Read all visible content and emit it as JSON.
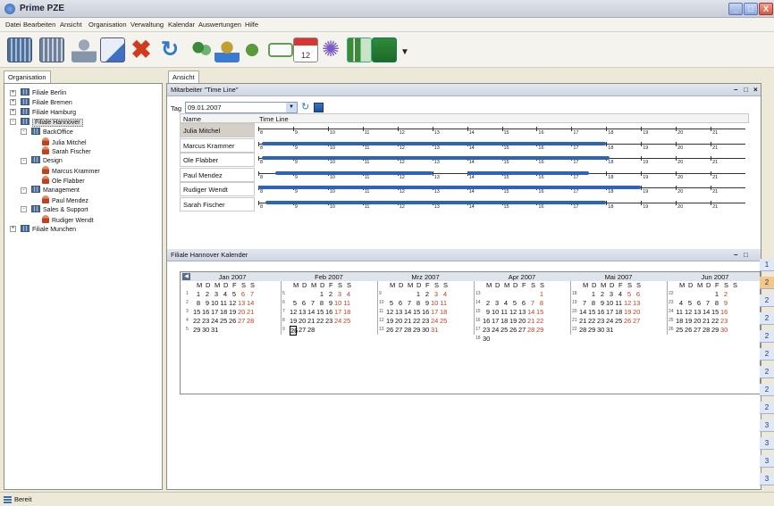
{
  "window": {
    "title": "Prime PZE",
    "btn_min": "_",
    "btn_max": "□",
    "btn_close": "X"
  },
  "menu": [
    "Datei",
    "Bearbeiten",
    "Ansicht",
    "Organisation",
    "Verwaltung",
    "Kalendar",
    "Auswertungen",
    "Hilfe"
  ],
  "toolbar": {
    "icons": [
      "table-icon",
      "database-icon",
      "user-icon",
      "edit-icon",
      "delete-icon",
      "refresh-icon",
      "users-group-icon",
      "export-icon",
      "import-icon",
      "tag-icon",
      "calendar-icon",
      "settings-icon",
      "chart-icon",
      "excel-icon",
      "dropdown-arrow-icon"
    ],
    "colors": {
      "accent": "#2f5fae",
      "delete": "#d23a1e",
      "excel": "#2f8a3a"
    }
  },
  "left_tab": "Organisation",
  "right_tab": "Ansicht",
  "tree": [
    {
      "label": "Filiale Berlin",
      "level": 0,
      "type": "folder",
      "exp": "+"
    },
    {
      "label": "Filiale Bremen",
      "level": 0,
      "type": "folder",
      "exp": "+"
    },
    {
      "label": "Filiale Hamburg",
      "level": 0,
      "type": "folder",
      "exp": "+"
    },
    {
      "label": "Filiale Hannover",
      "level": 0,
      "type": "folder",
      "exp": "-",
      "selected": true
    },
    {
      "label": "BackOffice",
      "level": 1,
      "type": "folder",
      "exp": "-"
    },
    {
      "label": "Julia Mitchel",
      "level": 2,
      "type": "person"
    },
    {
      "label": "Sarah Fischer",
      "level": 2,
      "type": "person"
    },
    {
      "label": "Design",
      "level": 1,
      "type": "folder",
      "exp": "-"
    },
    {
      "label": "Marcus Krammer",
      "level": 2,
      "type": "person"
    },
    {
      "label": "Ole Flabber",
      "level": 2,
      "type": "person"
    },
    {
      "label": "Management",
      "level": 1,
      "type": "folder",
      "exp": "-"
    },
    {
      "label": "Paul Mendez",
      "level": 2,
      "type": "person"
    },
    {
      "label": "Sales & Support",
      "level": 1,
      "type": "folder",
      "exp": "-"
    },
    {
      "label": "Rudiger Wendt",
      "level": 2,
      "type": "person"
    },
    {
      "label": "Filiale Munchen",
      "level": 0,
      "type": "folder",
      "exp": "+"
    }
  ],
  "timeline": {
    "panel_title": "Mitarbeiter \"Time Line\"",
    "tag_label": "Tag",
    "date_value": "09.01.2007",
    "col_name": "Name",
    "col_timeline": "Time Line",
    "hours": [
      "8",
      "9",
      "10",
      "11",
      "12",
      "13",
      "14",
      "15",
      "16",
      "17",
      "18",
      "19",
      "20",
      "21"
    ],
    "rows": [
      {
        "name": "Julia Mitchel",
        "selected": true,
        "bars": []
      },
      {
        "name": "Marcus Krammer",
        "bars": [
          [
            8.1,
            18.0
          ]
        ]
      },
      {
        "name": "Ole Flabber",
        "bars": [
          [
            8.1,
            18.1
          ]
        ]
      },
      {
        "name": "Paul Mendez",
        "bars": [
          [
            8.5,
            13.0
          ],
          [
            14.0,
            17.5
          ]
        ]
      },
      {
        "name": "Rudiger Wendt",
        "bars": [
          [
            8.0,
            15.5
          ],
          [
            15.0,
            19.0
          ]
        ]
      },
      {
        "name": "Sarah Fischer",
        "bars": [
          [
            8.2,
            18.0
          ]
        ]
      }
    ]
  },
  "calendar": {
    "panel_title": "Filiale Hannover Kalender",
    "dow": [
      "M",
      "D",
      "M",
      "D",
      "F",
      "S",
      "S"
    ],
    "months": [
      {
        "name": "Jan 2007",
        "weeks": [
          [
            1,
            1,
            2,
            3,
            4,
            5,
            6,
            7
          ],
          [
            2,
            8,
            9,
            10,
            11,
            12,
            13,
            14
          ],
          [
            3,
            15,
            16,
            17,
            18,
            19,
            20,
            21
          ],
          [
            4,
            22,
            23,
            24,
            25,
            26,
            27,
            28
          ],
          [
            5,
            29,
            30,
            31,
            0,
            0,
            0,
            0
          ]
        ]
      },
      {
        "name": "Feb 2007",
        "weeks": [
          [
            5,
            0,
            0,
            0,
            1,
            2,
            3,
            4
          ],
          [
            6,
            5,
            6,
            7,
            8,
            9,
            10,
            11
          ],
          [
            7,
            12,
            13,
            14,
            15,
            16,
            17,
            18
          ],
          [
            8,
            19,
            20,
            21,
            22,
            23,
            24,
            25
          ],
          [
            9,
            26,
            27,
            28,
            0,
            0,
            0,
            0
          ]
        ],
        "today": 26
      },
      {
        "name": "Mrz 2007",
        "weeks": [
          [
            9,
            0,
            0,
            0,
            1,
            2,
            3,
            4
          ],
          [
            10,
            5,
            6,
            7,
            8,
            9,
            10,
            11
          ],
          [
            11,
            12,
            13,
            14,
            15,
            16,
            17,
            18
          ],
          [
            12,
            19,
            20,
            21,
            22,
            23,
            24,
            25
          ],
          [
            13,
            26,
            27,
            28,
            29,
            30,
            31,
            0
          ]
        ]
      },
      {
        "name": "Apr 2007",
        "weeks": [
          [
            13,
            0,
            0,
            0,
            0,
            0,
            0,
            1
          ],
          [
            14,
            2,
            3,
            4,
            5,
            6,
            7,
            8
          ],
          [
            15,
            9,
            10,
            11,
            12,
            13,
            14,
            15
          ],
          [
            16,
            16,
            17,
            18,
            19,
            20,
            21,
            22
          ],
          [
            17,
            23,
            24,
            25,
            26,
            27,
            28,
            29
          ],
          [
            18,
            30,
            0,
            0,
            0,
            0,
            0,
            0
          ]
        ]
      },
      {
        "name": "Mai 2007",
        "weeks": [
          [
            18,
            0,
            1,
            2,
            3,
            4,
            5,
            6
          ],
          [
            19,
            7,
            8,
            9,
            10,
            11,
            12,
            13
          ],
          [
            20,
            14,
            15,
            16,
            17,
            18,
            19,
            20
          ],
          [
            21,
            21,
            22,
            23,
            24,
            25,
            26,
            27
          ],
          [
            22,
            28,
            29,
            30,
            31,
            0,
            0,
            0
          ]
        ]
      },
      {
        "name": "Jun 2007",
        "weeks": [
          [
            22,
            0,
            0,
            0,
            0,
            1,
            2,
            0
          ],
          [
            23,
            4,
            5,
            6,
            7,
            8,
            9,
            0
          ],
          [
            24,
            11,
            12,
            13,
            14,
            15,
            16,
            0
          ],
          [
            25,
            18,
            19,
            20,
            21,
            22,
            23,
            0
          ],
          [
            26,
            25,
            26,
            27,
            28,
            29,
            30,
            0
          ]
        ]
      }
    ]
  },
  "side_numbers": [
    "1",
    "2",
    "2",
    "2",
    "2",
    "2",
    "2",
    "2",
    "2",
    "3",
    "3",
    "3",
    "3"
  ],
  "status": "Bereit"
}
